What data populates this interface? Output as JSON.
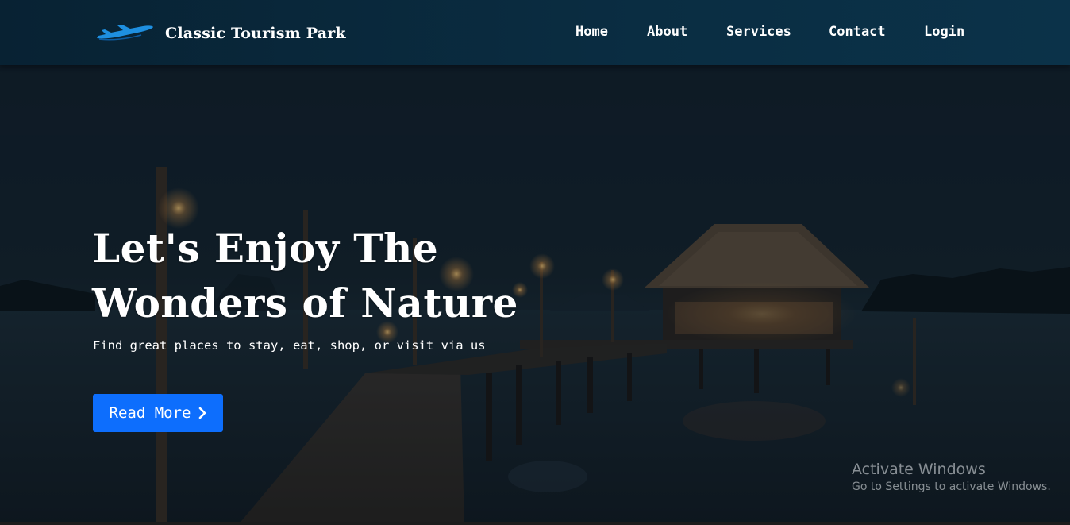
{
  "brand": {
    "name": "Classic Tourism Park",
    "icon": "airplane-icon",
    "icon_color": "#1e8fe0"
  },
  "nav": {
    "items": [
      {
        "label": "Home"
      },
      {
        "label": "About"
      },
      {
        "label": "Services"
      },
      {
        "label": "Contact"
      },
      {
        "label": "Login"
      }
    ]
  },
  "hero": {
    "title": "Let's Enjoy The Wonders of Nature",
    "subtitle": "Find great places to stay, eat, shop, or visit via us",
    "button_label": "Read More",
    "button_icon": "chevron-right-icon",
    "button_color": "#0d6efd"
  },
  "watermark": {
    "title": "Activate Windows",
    "subtitle": "Go to Settings to activate Windows."
  },
  "colors": {
    "navbar": "#0a2d42",
    "text": "#ffffff"
  }
}
